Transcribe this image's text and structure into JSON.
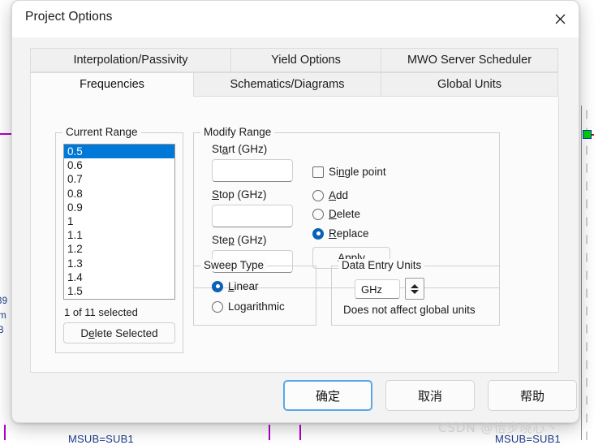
{
  "window": {
    "title": "Project Options",
    "close_icon": "close-icon"
  },
  "tabs": {
    "row1": [
      {
        "label": "Interpolation/Passivity",
        "selected": false
      },
      {
        "label": "Yield Options",
        "selected": false
      },
      {
        "label": "MWO Server Scheduler",
        "selected": false
      }
    ],
    "row2": [
      {
        "label": "Frequencies",
        "selected": true
      },
      {
        "label": "Schematics/Diagrams",
        "selected": false
      },
      {
        "label": "Global Units",
        "selected": false
      }
    ]
  },
  "current_range": {
    "group_title": "Current Range",
    "items": [
      "0.5",
      "0.6",
      "0.7",
      "0.8",
      "0.9",
      "1",
      "1.1",
      "1.2",
      "1.3",
      "1.4",
      "1.5"
    ],
    "selected_index": 0,
    "selection_status": "1 of 11 selected",
    "delete_button": "Delete Selected",
    "delete_button_accel": "e"
  },
  "modify_range": {
    "group_title": "Modify Range",
    "start_label": "Start (GHz)",
    "start_value": "",
    "stop_label": "Stop (GHz)",
    "stop_value": "",
    "step_label": "Step (GHz)",
    "step_value": "",
    "single_point_label": "Single point",
    "single_point_checked": false,
    "add_label": "Add",
    "add_checked": false,
    "delete_label": "Delete",
    "delete_checked": false,
    "replace_label": "Replace",
    "replace_checked": true,
    "apply_label": "Apply"
  },
  "sweep_type": {
    "group_title": "Sweep Type",
    "linear_label": "Linear",
    "linear_checked": true,
    "log_label": "Logarithmic",
    "log_checked": false
  },
  "data_entry_units": {
    "group_title": "Data Entry Units",
    "unit_value": "GHz",
    "spinner_up_icon": "chevron-up-icon",
    "spinner_down_icon": "chevron-down-icon",
    "note": "Does not affect global units"
  },
  "footer": {
    "ok_label": "确定",
    "cancel_label": "取消",
    "help_label": "帮助"
  },
  "background": {
    "watermark": "CSDN @怡步晓心丶",
    "schematic_labels": [
      "MSUB=SUB1",
      "MSUB=SUB1"
    ],
    "left_fragments": [
      "39",
      "m",
      "B"
    ],
    "accent_wire_color": "#b000c8",
    "port_color": "#00d000"
  }
}
